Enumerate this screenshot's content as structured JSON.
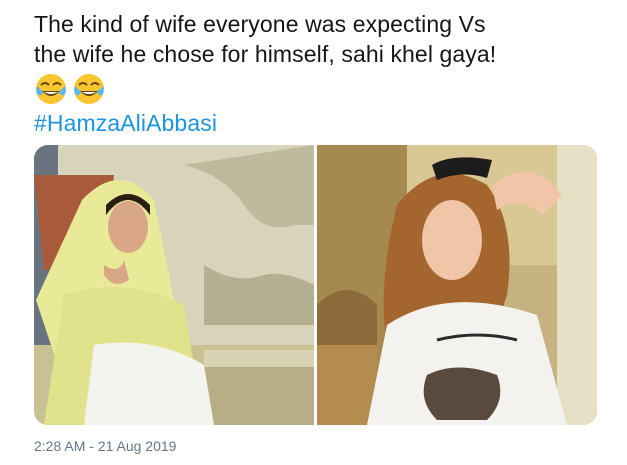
{
  "tweet": {
    "text_line_1": "The kind of wife everyone was expecting Vs",
    "text_line_2": "the wife he chose for himself, sahi khel gaya!",
    "emojis": [
      "face-with-tears-of-joy-icon",
      "face-with-tears-of-joy-icon"
    ],
    "hashtag": "#HamzaAliAbbasi",
    "timestamp": "2:28 AM - 21 Aug 2019"
  },
  "media": {
    "photos": [
      {
        "name": "photo-woman-yellow-dupatta"
      },
      {
        "name": "photo-woman-sunglasses-white-tshirt"
      }
    ]
  },
  "colors": {
    "text": "#14171a",
    "link": "#1b95e0",
    "meta": "#657786"
  }
}
